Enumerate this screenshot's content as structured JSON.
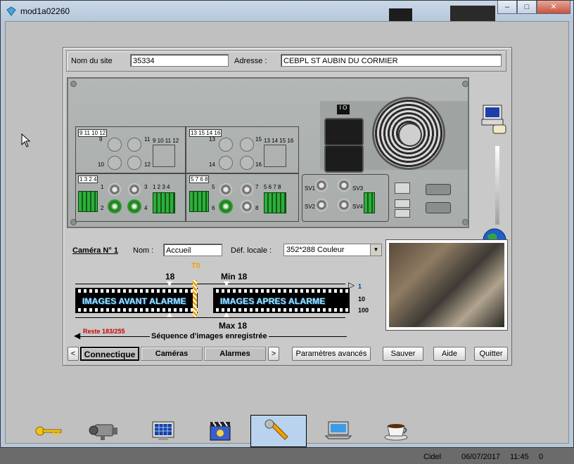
{
  "window": {
    "title": "mod1a02260",
    "buttons": {
      "minimize": "‒",
      "maximize": "□",
      "close": "✕"
    }
  },
  "site": {
    "name_label": "Nom du site",
    "name_value": "35334",
    "address_label": "Adresse :",
    "address_value": "CEBPL ST AUBIN DU CORMIER"
  },
  "device": {
    "group_labels": [
      "9 11 10 12",
      "13 15 14 16",
      "1 3 2 4",
      "5 7 6 8"
    ],
    "input_numbers": [
      "9",
      "10",
      "11",
      "12",
      "13",
      "14",
      "15",
      "16",
      "1",
      "2",
      "3",
      "4",
      "5",
      "6",
      "7",
      "8"
    ],
    "terminal_labels": [
      "9 10 11 12",
      "13 14 15 16",
      "1 2 3 4",
      "5 6 7 8"
    ],
    "sv_labels": [
      "SV1",
      "SV2",
      "SV3",
      "SV4"
    ],
    "switch_label": "I O"
  },
  "camera": {
    "title": "Caméra N° 1",
    "name_label": "Nom :",
    "name_value": "Accueil",
    "resolution_label": "Déf. locale :",
    "resolution_value": "352*288 Couleur"
  },
  "timeline": {
    "before_count": "18",
    "t0": "T0",
    "min_label": "Min 18",
    "max_label": "Max 18",
    "before_text": "IMAGES AVANT ALARME",
    "after_text": "IMAGES APRES ALARME",
    "speed_options": [
      "1",
      "10",
      "100"
    ],
    "remaining": "Reste 183/255",
    "sequence_label": "Séquence d'images enregistrée"
  },
  "tabs": {
    "prev": "<",
    "next": ">",
    "items": [
      "Connectique",
      "Caméras",
      "Alarmes"
    ],
    "active": "Connectique"
  },
  "actions": {
    "advanced": "Paramètres avancés",
    "save": "Sauver",
    "help": "Aide",
    "quit": "Quitter"
  },
  "taskbar_icons": [
    "key-icon",
    "camera-icon",
    "monitor-grid-icon",
    "clapper-icon",
    "wrench-icon",
    "laptop-icon",
    "coffee-icon"
  ],
  "status": {
    "user": "Cidel",
    "date": "06/07/2017",
    "time": "11:45",
    "count": "0"
  },
  "colors": {
    "accent_blue": "#b9d3ee",
    "remaining_red": "#cc0000",
    "film_text": "#9fe6ff",
    "t0_orange": "#f0a000"
  }
}
